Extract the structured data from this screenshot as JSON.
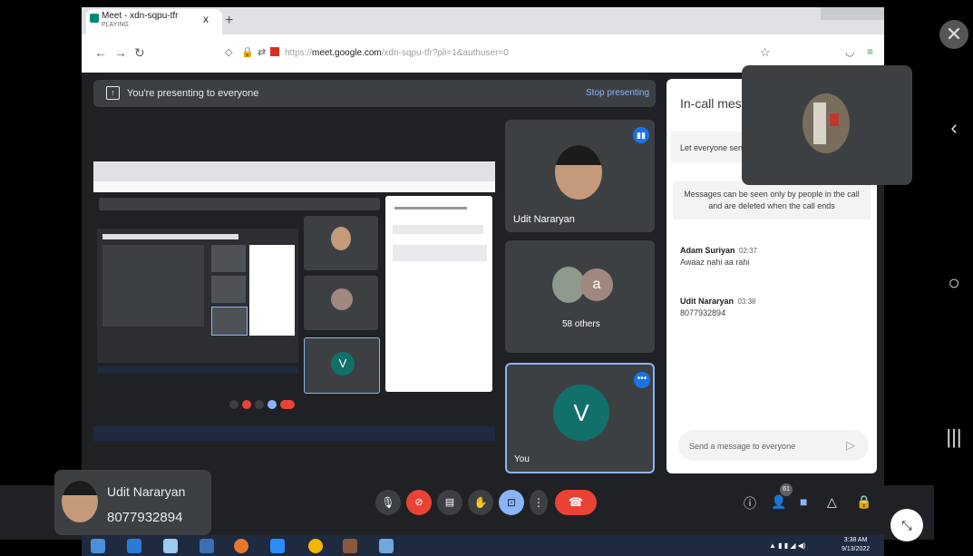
{
  "browser": {
    "tab_title": "Meet - xdn-sqpu-tfr",
    "tab_sub": "PLAYING",
    "tab_close": "x",
    "tab_new": "+",
    "url_prefix": "https://",
    "url_domain": "meet.google.com",
    "url_path": "/xdn-sqpu-tfr?pli=1&authuser=0"
  },
  "meet": {
    "presenting_text": "You're presenting to everyone",
    "stop_presenting": "Stop presenting",
    "tiles": {
      "participant_name": "Udit Nararyan",
      "others_label": "58 others",
      "others_avatar_letter": "a",
      "you_label": "You",
      "you_letter": "V"
    },
    "participant_count": "61"
  },
  "chat": {
    "title": "In-call messa",
    "toggle_text": "Let everyone send",
    "info": "Messages can be seen only by people in the call and are deleted when the call ends",
    "messages": [
      {
        "name": "Adam Suriyan",
        "time": "02:37",
        "text": "Awaaz nahi aa rahi"
      },
      {
        "name": "Udit Nararyan",
        "time": "03:38",
        "text": "8077932894"
      }
    ],
    "placeholder": "Send a message to everyone"
  },
  "pip": {
    "name": "Udit Nararyan",
    "number": "8077932894"
  },
  "taskbar": {
    "time": "3:38 AM",
    "date": "9/13/2022"
  },
  "colors": {
    "meet_bg": "#202124",
    "tile_bg": "#3c4043",
    "accent_blue": "#8ab4f8",
    "end_call_red": "#ea4335",
    "avatar_teal": "#12706b"
  }
}
